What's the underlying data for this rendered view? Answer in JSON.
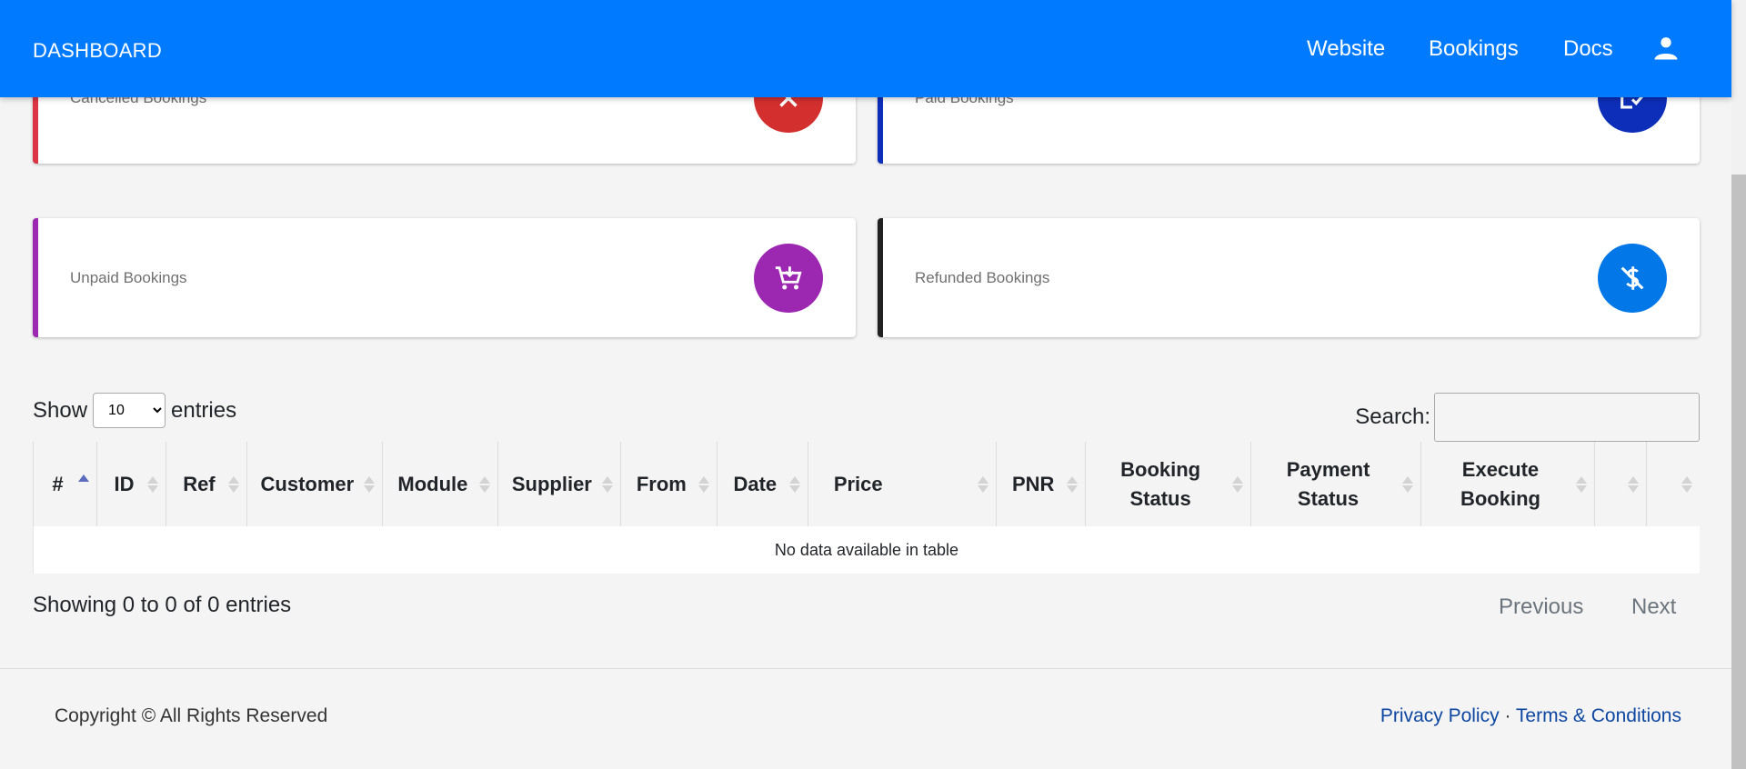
{
  "navbar": {
    "brand": "DASHBOARD",
    "links": [
      "Website",
      "Bookings",
      "Docs"
    ],
    "user_icon": "user-icon",
    "color": "#007bff"
  },
  "cards": [
    {
      "label": "Cancelled Bookings",
      "icon": "close-icon",
      "accent": "#dc3545",
      "circle": "#d32f2f"
    },
    {
      "label": "Paid Bookings",
      "icon": "checklist-icon",
      "accent": "#0d2eb8",
      "circle": "#0d2eb8"
    },
    {
      "label": "Unpaid Bookings",
      "icon": "cart-icon",
      "accent": "#9c27b0",
      "circle": "#9c27b0"
    },
    {
      "label": "Refunded Bookings",
      "icon": "money-off-icon",
      "accent": "#212121",
      "circle": "#0277e8"
    }
  ],
  "table_controls": {
    "show_label": "Show",
    "entries_value": "10",
    "entries_label": "entries",
    "search_label": "Search:",
    "search_value": ""
  },
  "table": {
    "columns": [
      "#",
      "ID",
      "Ref",
      "Customer",
      "Module",
      "Supplier",
      "From",
      "Date",
      "Price",
      "PNR",
      "Booking Status",
      "Payment Status",
      "Execute Booking",
      "",
      ""
    ],
    "sorted_column": "#",
    "empty_message": "No data available in table"
  },
  "pagination": {
    "info": "Showing 0 to 0 of 0 entries",
    "previous": "Previous",
    "next": "Next"
  },
  "footer": {
    "copyright": "Copyright © All Rights Reserved",
    "privacy": "Privacy Policy",
    "separator": "·",
    "terms": "Terms & Conditions"
  }
}
